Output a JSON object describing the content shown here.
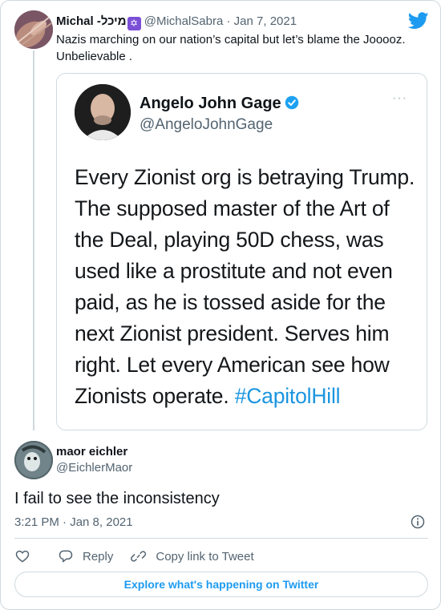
{
  "parent_tweet": {
    "display_name": "Michal -מיכל",
    "badge_emoji": "✡",
    "handle": "@MichalSabra",
    "separator": " · ",
    "date": "Jan 7, 2021",
    "text": "Nazis marching on our nation’s capital but let’s blame the Jooooz. Unbelievable ."
  },
  "quoted_tweet": {
    "display_name": "Angelo John Gage",
    "handle": "@AngeloJohnGage",
    "more": "···",
    "text": "Every Zionist org is betraying Trump. The supposed master of the Art of the Deal, playing 50D chess, was used like a prostitute and not even paid, as he is tossed aside for the next Zionist president. Serves him right. Let every American see how Zionists operate.",
    "hashtag": "#CapitolHill"
  },
  "reply_tweet": {
    "display_name": "maor eichler",
    "handle": "@EichlerMaor",
    "text": "I fail to see the inconsistency",
    "timestamp": "3:21 PM · Jan 8, 2021"
  },
  "actions": {
    "reply_label": "Reply",
    "copy_link_label": "Copy link to Tweet"
  },
  "explore_label": "Explore what's happening on Twitter",
  "colors": {
    "accent": "#1d9bf0",
    "hashtag": "#1b95e0",
    "border": "#cfd9de",
    "muted": "#536471",
    "badge": "#7b4fd6"
  },
  "icons": [
    "twitter-bird-icon",
    "verified-badge-icon",
    "info-icon",
    "heart-icon",
    "reply-icon",
    "link-icon"
  ]
}
